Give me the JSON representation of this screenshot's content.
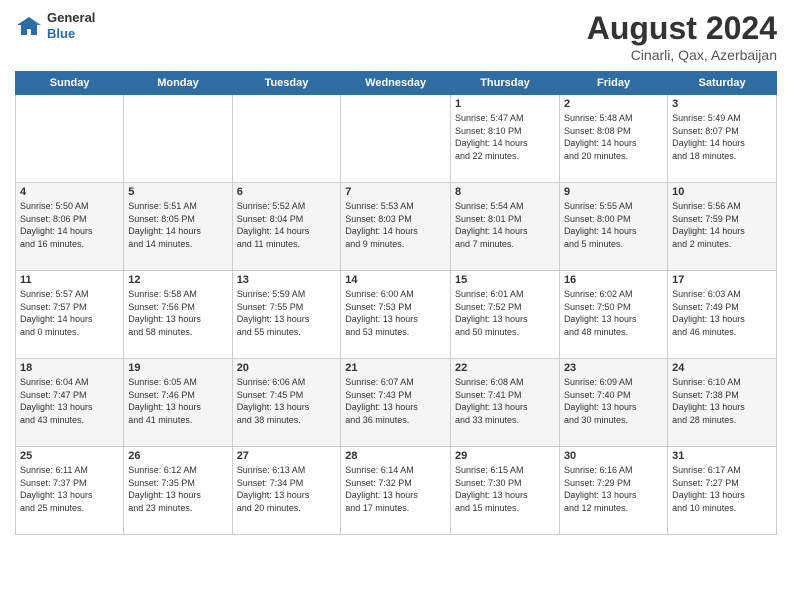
{
  "header": {
    "logo_line1": "General",
    "logo_line2": "Blue",
    "month": "August 2024",
    "location": "Cinarli, Qax, Azerbaijan"
  },
  "weekdays": [
    "Sunday",
    "Monday",
    "Tuesday",
    "Wednesday",
    "Thursday",
    "Friday",
    "Saturday"
  ],
  "weeks": [
    [
      {
        "day": "",
        "info": ""
      },
      {
        "day": "",
        "info": ""
      },
      {
        "day": "",
        "info": ""
      },
      {
        "day": "",
        "info": ""
      },
      {
        "day": "1",
        "info": "Sunrise: 5:47 AM\nSunset: 8:10 PM\nDaylight: 14 hours\nand 22 minutes."
      },
      {
        "day": "2",
        "info": "Sunrise: 5:48 AM\nSunset: 8:08 PM\nDaylight: 14 hours\nand 20 minutes."
      },
      {
        "day": "3",
        "info": "Sunrise: 5:49 AM\nSunset: 8:07 PM\nDaylight: 14 hours\nand 18 minutes."
      }
    ],
    [
      {
        "day": "4",
        "info": "Sunrise: 5:50 AM\nSunset: 8:06 PM\nDaylight: 14 hours\nand 16 minutes."
      },
      {
        "day": "5",
        "info": "Sunrise: 5:51 AM\nSunset: 8:05 PM\nDaylight: 14 hours\nand 14 minutes."
      },
      {
        "day": "6",
        "info": "Sunrise: 5:52 AM\nSunset: 8:04 PM\nDaylight: 14 hours\nand 11 minutes."
      },
      {
        "day": "7",
        "info": "Sunrise: 5:53 AM\nSunset: 8:03 PM\nDaylight: 14 hours\nand 9 minutes."
      },
      {
        "day": "8",
        "info": "Sunrise: 5:54 AM\nSunset: 8:01 PM\nDaylight: 14 hours\nand 7 minutes."
      },
      {
        "day": "9",
        "info": "Sunrise: 5:55 AM\nSunset: 8:00 PM\nDaylight: 14 hours\nand 5 minutes."
      },
      {
        "day": "10",
        "info": "Sunrise: 5:56 AM\nSunset: 7:59 PM\nDaylight: 14 hours\nand 2 minutes."
      }
    ],
    [
      {
        "day": "11",
        "info": "Sunrise: 5:57 AM\nSunset: 7:57 PM\nDaylight: 14 hours\nand 0 minutes."
      },
      {
        "day": "12",
        "info": "Sunrise: 5:58 AM\nSunset: 7:56 PM\nDaylight: 13 hours\nand 58 minutes."
      },
      {
        "day": "13",
        "info": "Sunrise: 5:59 AM\nSunset: 7:55 PM\nDaylight: 13 hours\nand 55 minutes."
      },
      {
        "day": "14",
        "info": "Sunrise: 6:00 AM\nSunset: 7:53 PM\nDaylight: 13 hours\nand 53 minutes."
      },
      {
        "day": "15",
        "info": "Sunrise: 6:01 AM\nSunset: 7:52 PM\nDaylight: 13 hours\nand 50 minutes."
      },
      {
        "day": "16",
        "info": "Sunrise: 6:02 AM\nSunset: 7:50 PM\nDaylight: 13 hours\nand 48 minutes."
      },
      {
        "day": "17",
        "info": "Sunrise: 6:03 AM\nSunset: 7:49 PM\nDaylight: 13 hours\nand 46 minutes."
      }
    ],
    [
      {
        "day": "18",
        "info": "Sunrise: 6:04 AM\nSunset: 7:47 PM\nDaylight: 13 hours\nand 43 minutes."
      },
      {
        "day": "19",
        "info": "Sunrise: 6:05 AM\nSunset: 7:46 PM\nDaylight: 13 hours\nand 41 minutes."
      },
      {
        "day": "20",
        "info": "Sunrise: 6:06 AM\nSunset: 7:45 PM\nDaylight: 13 hours\nand 38 minutes."
      },
      {
        "day": "21",
        "info": "Sunrise: 6:07 AM\nSunset: 7:43 PM\nDaylight: 13 hours\nand 36 minutes."
      },
      {
        "day": "22",
        "info": "Sunrise: 6:08 AM\nSunset: 7:41 PM\nDaylight: 13 hours\nand 33 minutes."
      },
      {
        "day": "23",
        "info": "Sunrise: 6:09 AM\nSunset: 7:40 PM\nDaylight: 13 hours\nand 30 minutes."
      },
      {
        "day": "24",
        "info": "Sunrise: 6:10 AM\nSunset: 7:38 PM\nDaylight: 13 hours\nand 28 minutes."
      }
    ],
    [
      {
        "day": "25",
        "info": "Sunrise: 6:11 AM\nSunset: 7:37 PM\nDaylight: 13 hours\nand 25 minutes."
      },
      {
        "day": "26",
        "info": "Sunrise: 6:12 AM\nSunset: 7:35 PM\nDaylight: 13 hours\nand 23 minutes."
      },
      {
        "day": "27",
        "info": "Sunrise: 6:13 AM\nSunset: 7:34 PM\nDaylight: 13 hours\nand 20 minutes."
      },
      {
        "day": "28",
        "info": "Sunrise: 6:14 AM\nSunset: 7:32 PM\nDaylight: 13 hours\nand 17 minutes."
      },
      {
        "day": "29",
        "info": "Sunrise: 6:15 AM\nSunset: 7:30 PM\nDaylight: 13 hours\nand 15 minutes."
      },
      {
        "day": "30",
        "info": "Sunrise: 6:16 AM\nSunset: 7:29 PM\nDaylight: 13 hours\nand 12 minutes."
      },
      {
        "day": "31",
        "info": "Sunrise: 6:17 AM\nSunset: 7:27 PM\nDaylight: 13 hours\nand 10 minutes."
      }
    ]
  ]
}
